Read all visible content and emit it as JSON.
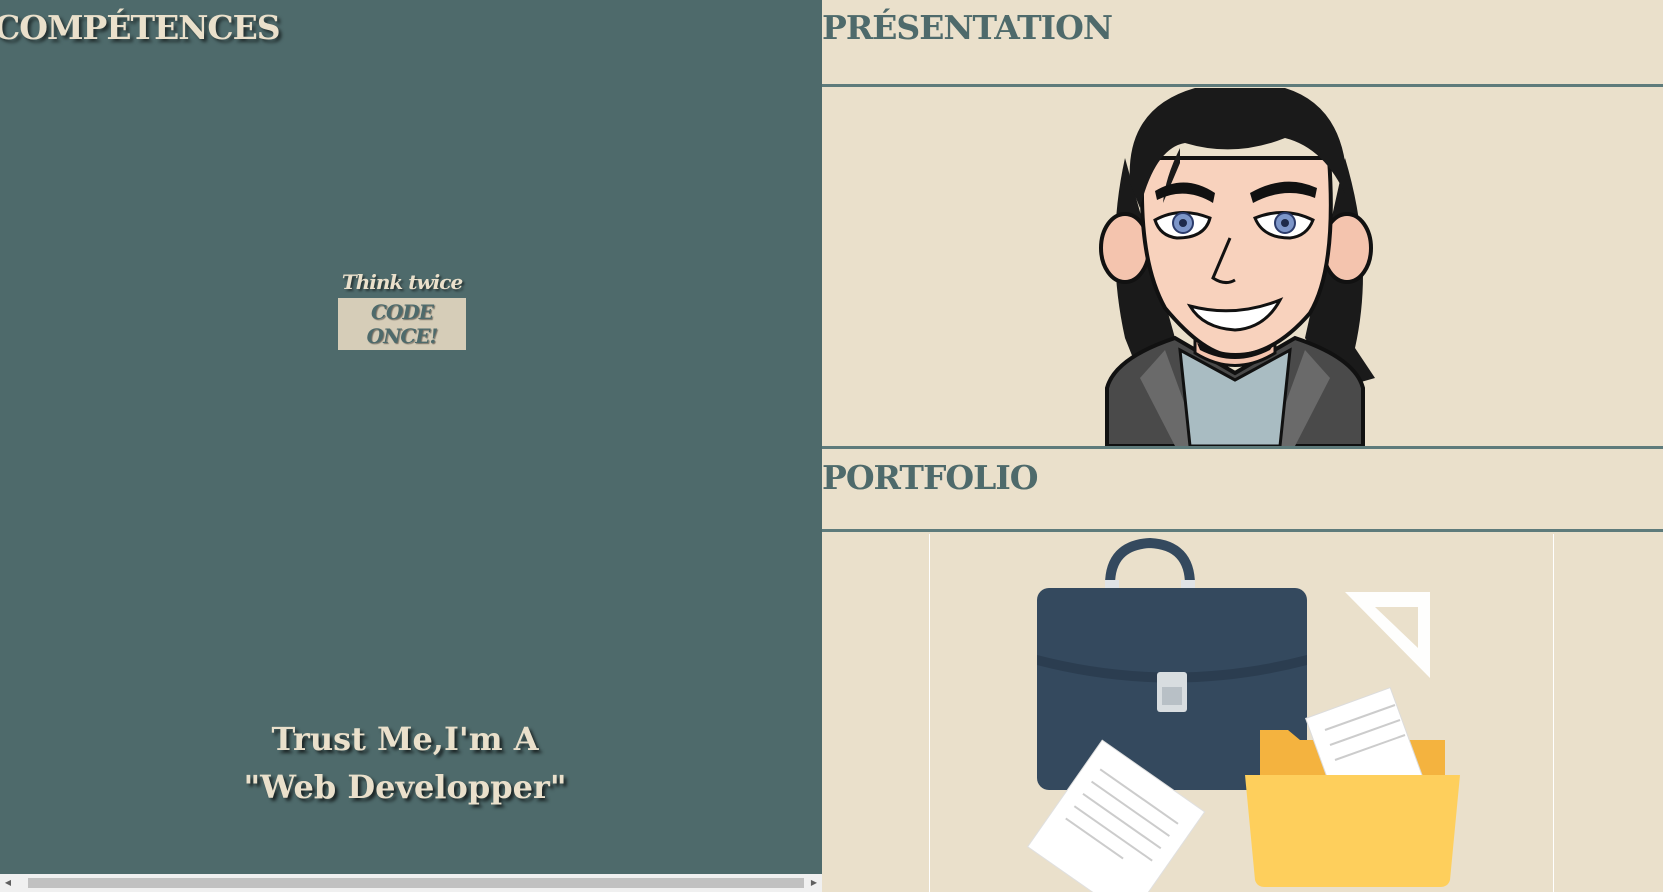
{
  "left": {
    "title": "COMPÉTENCES",
    "motto_top": "Think twice",
    "motto_bottom": "CODE ONCE!",
    "tagline_line1": "Trust Me,I'm A",
    "tagline_line2": "\"Web Developper\""
  },
  "right": {
    "presentation_title": "PRÉSENTATION",
    "portfolio_title": "PORTFOLIO"
  },
  "colors": {
    "panel_teal": "#4e6a6b",
    "cream": "#eae0cb",
    "briefcase_navy": "#34495e",
    "folder_yellow": "#fecf5c"
  },
  "icons": {
    "avatar": "cartoon-developer-avatar",
    "portfolio": "briefcase-folder-illustration"
  }
}
